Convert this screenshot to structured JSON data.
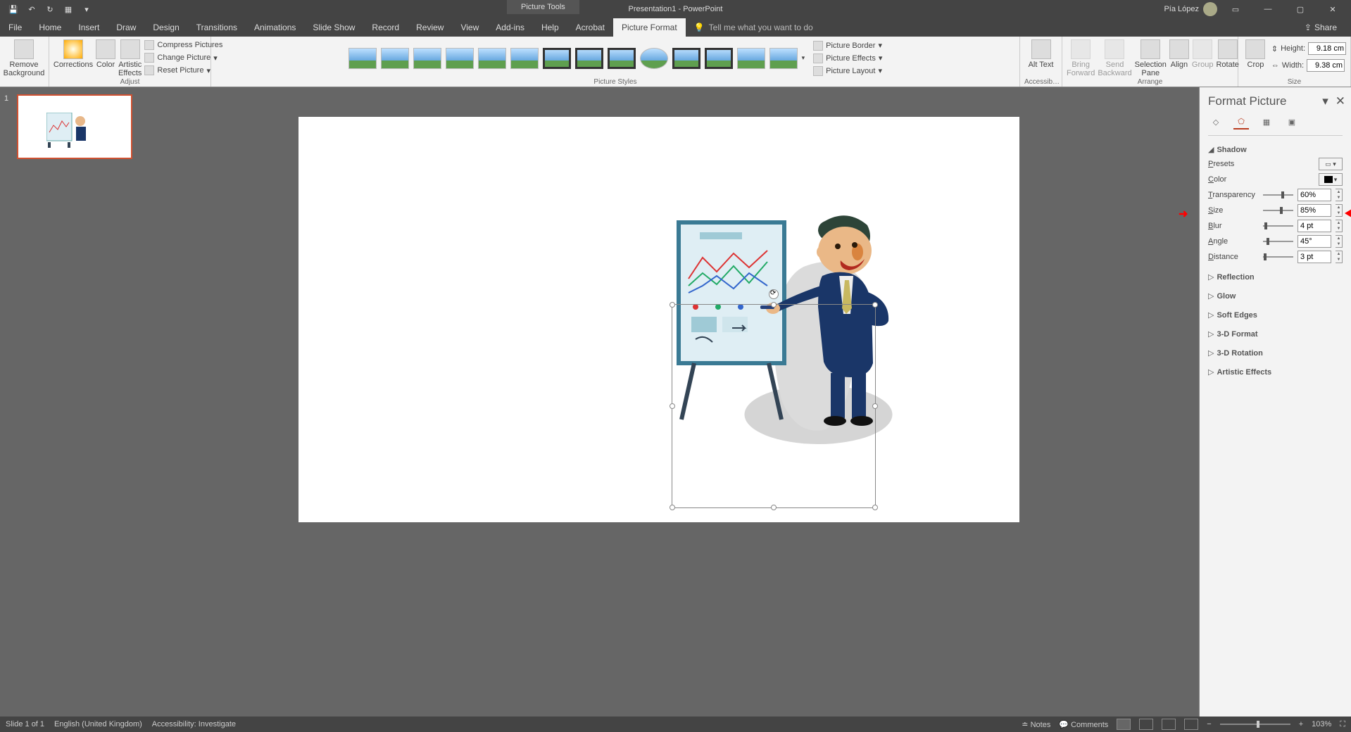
{
  "titlebar": {
    "doc_title": "Presentation1 - PowerPoint",
    "picture_tools": "Picture Tools",
    "user_name": "Pía López"
  },
  "menu": {
    "items": [
      "File",
      "Home",
      "Insert",
      "Draw",
      "Design",
      "Transitions",
      "Animations",
      "Slide Show",
      "Record",
      "Review",
      "View",
      "Add-ins",
      "Help",
      "Acrobat",
      "Picture Format"
    ],
    "active_index": 14,
    "tell_me": "Tell me what you want to do",
    "share": "Share"
  },
  "ribbon": {
    "remove_bg": "Remove Background",
    "corrections": "Corrections",
    "color": "Color",
    "artistic": "Artistic Effects",
    "compress": "Compress Pictures",
    "change": "Change Picture",
    "reset": "Reset Picture",
    "group_adjust": "Adjust",
    "group_styles": "Picture Styles",
    "border": "Picture Border",
    "effects": "Picture Effects",
    "layout": "Picture Layout",
    "alt_text": "Alt Text",
    "accessib": "Accessib…",
    "bring_fwd": "Bring Forward",
    "send_back": "Send Backward",
    "sel_pane": "Selection Pane",
    "align": "Align",
    "group": "Group",
    "rotate": "Rotate",
    "group_arrange": "Arrange",
    "crop": "Crop",
    "height_lbl": "Height:",
    "width_lbl": "Width:",
    "height_val": "9.18 cm",
    "width_val": "9.38 cm",
    "group_size": "Size"
  },
  "thumb": {
    "num": "1"
  },
  "fp": {
    "title": "Format Picture",
    "shadow": "Shadow",
    "presets": "Presets",
    "color": "Color",
    "transparency": "Transparency",
    "size": "Size",
    "blur": "Blur",
    "angle": "Angle",
    "distance": "Distance",
    "transparency_val": "60%",
    "size_val": "85%",
    "blur_val": "4 pt",
    "angle_val": "45°",
    "distance_val": "3 pt",
    "reflection": "Reflection",
    "glow": "Glow",
    "soft_edges": "Soft Edges",
    "threed_format": "3-D Format",
    "threed_rotation": "3-D Rotation",
    "artistic": "Artistic Effects"
  },
  "status": {
    "slide": "Slide 1 of 1",
    "lang": "English (United Kingdom)",
    "access": "Accessibility: Investigate",
    "notes": "Notes",
    "comments": "Comments",
    "zoom": "103%"
  }
}
